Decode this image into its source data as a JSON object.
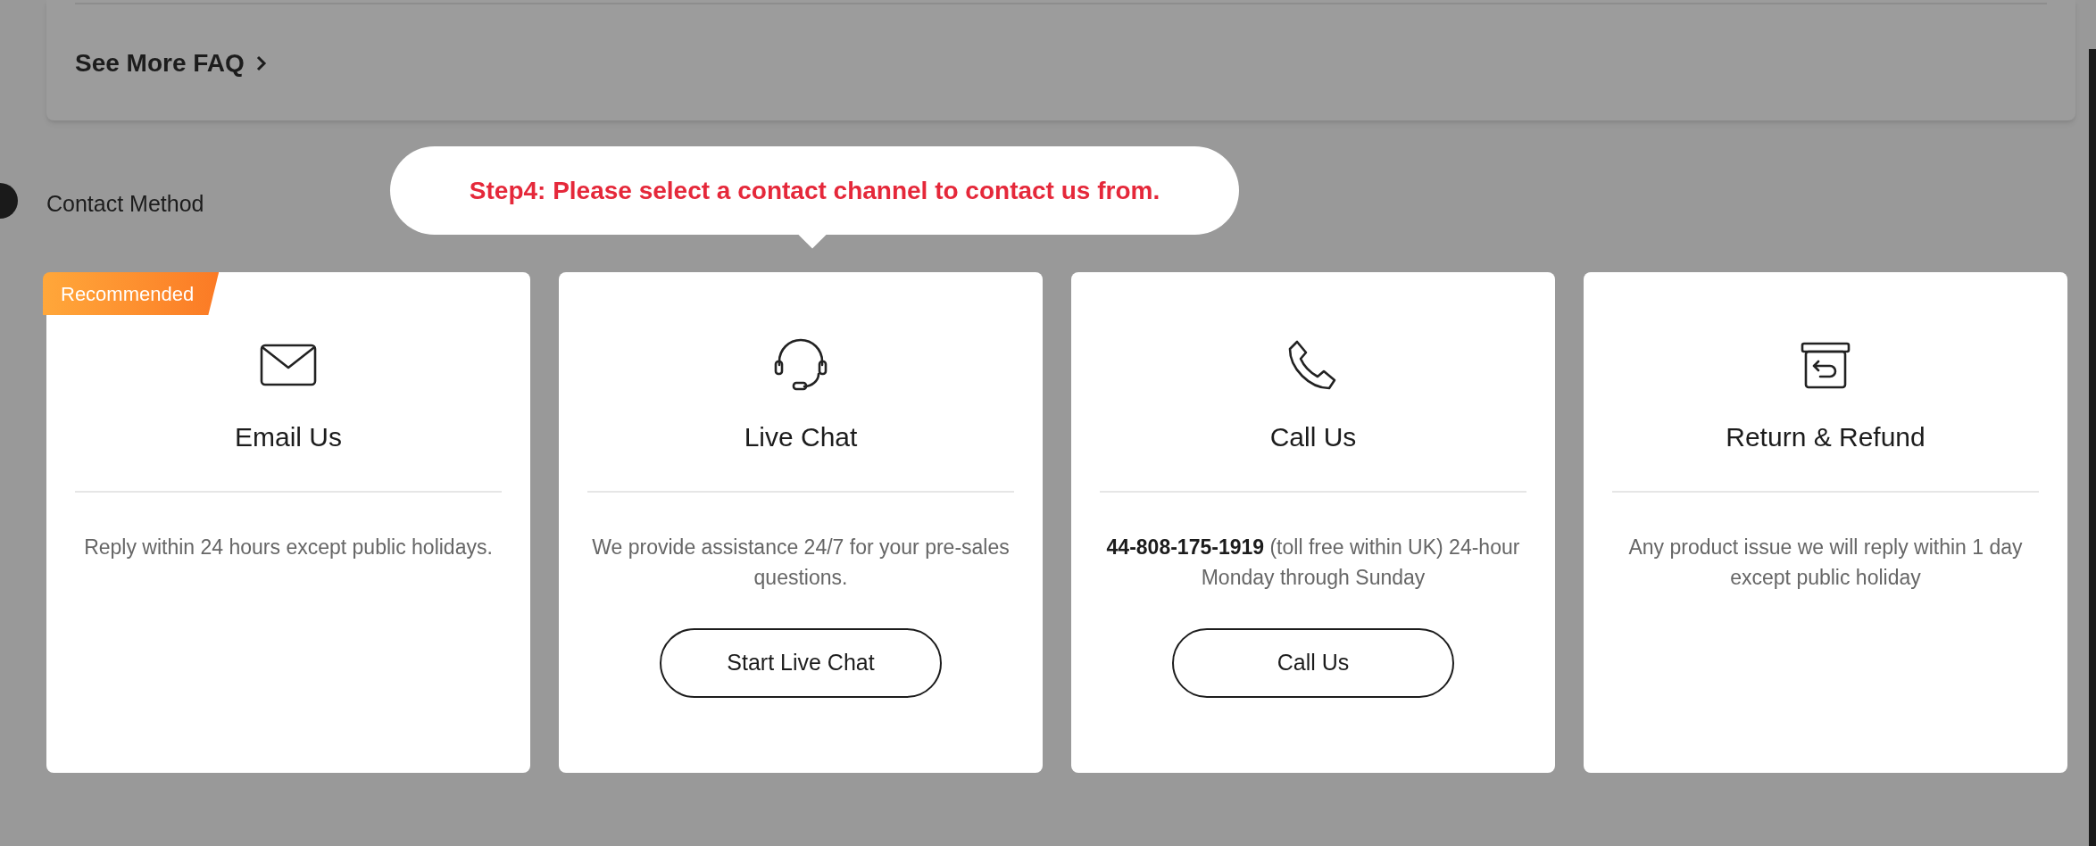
{
  "faq": {
    "link": "See More FAQ"
  },
  "section": {
    "title": "Contact Method"
  },
  "tooltip": {
    "text": "Step4: Please select a contact channel to contact us from."
  },
  "cards": [
    {
      "kind": "email",
      "badge": "Recommended",
      "title": "Email Us",
      "description": "Reply within 24 hours except public holidays."
    },
    {
      "kind": "chat",
      "title": "Live Chat",
      "description": "We provide assistance 24/7 for your pre-sales questions.",
      "button": "Start Live Chat"
    },
    {
      "kind": "phone",
      "title": "Call Us",
      "description": "**44-808-175-1919** (toll free within UK) 24-hour Monday through Sunday",
      "button": "Call Us"
    },
    {
      "kind": "return",
      "title": "Return & Refund",
      "description": "Any product issue we will reply within 1 day except public holiday"
    }
  ]
}
